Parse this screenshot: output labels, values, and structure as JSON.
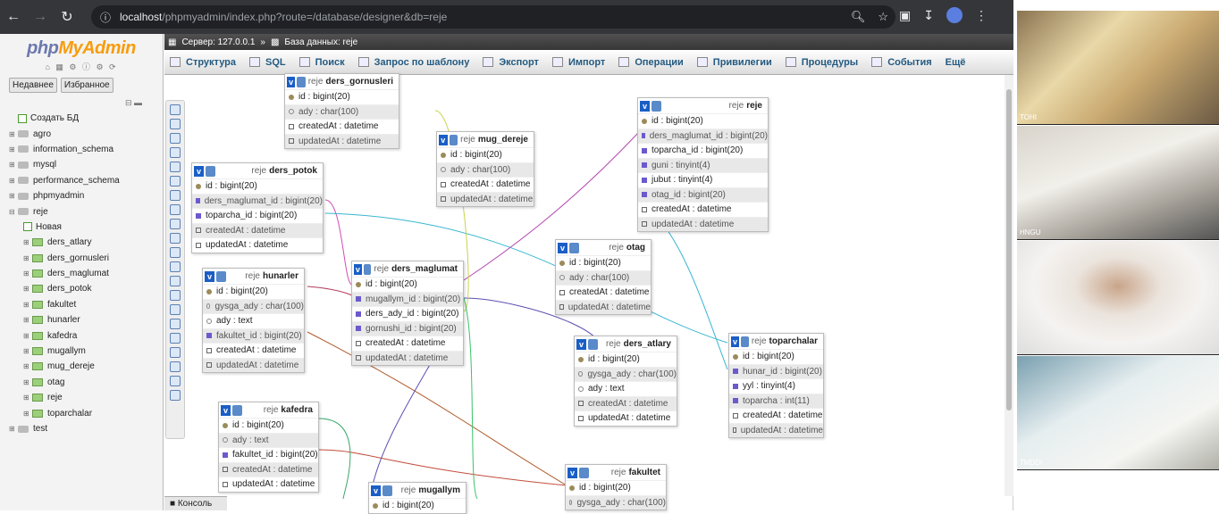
{
  "browser": {
    "url_prefix": "localhost",
    "url_path": "/phpmyadmin/index.php?route=/database/designer&db=reje"
  },
  "logo": {
    "php": "php",
    "myadmin": "MyAdmin"
  },
  "left": {
    "tab_recent": "Недавнее",
    "tab_favorites": "Избранное",
    "create_db": "Создать БД",
    "databases": [
      "agro",
      "information_schema",
      "mysql",
      "performance_schema",
      "phpmyadmin",
      "reje"
    ],
    "new_item": "Новая",
    "tables": [
      "ders_atlary",
      "ders_gornusleri",
      "ders_maglumat",
      "ders_potok",
      "fakultet",
      "hunarler",
      "kafedra",
      "mugallym",
      "mug_dereje",
      "otag",
      "reje",
      "toparchalar"
    ],
    "test_db": "test"
  },
  "pathbar": {
    "server": "Сервер: 127.0.0.1",
    "sep": "»",
    "db": "База данных: reje"
  },
  "tabs": [
    "Структура",
    "SQL",
    "Поиск",
    "Запрос по шаблону",
    "Экспорт",
    "Импорт",
    "Операции",
    "Привилегии",
    "Процедуры",
    "События",
    "Ещё"
  ],
  "console": "Консоль",
  "db_prefix": "reje",
  "designer_tables": {
    "ders_gornusleri": {
      "name": "ders_gornusleri",
      "rows": [
        "id : bigint(20)",
        "ady : char(100)",
        "createdAt : datetime",
        "updatedAt : datetime"
      ]
    },
    "ders_potok": {
      "name": "ders_potok",
      "rows": [
        "id : bigint(20)",
        "ders_maglumat_id : bigint(20)",
        "toparcha_id : bigint(20)",
        "createdAt : datetime",
        "updatedAt : datetime"
      ]
    },
    "mug_dereje": {
      "name": "mug_dereje",
      "rows": [
        "id : bigint(20)",
        "ady : char(100)",
        "createdAt : datetime",
        "updatedAt : datetime"
      ]
    },
    "reje": {
      "name": "reje",
      "rows": [
        "id : bigint(20)",
        "ders_maglumat_id : bigint(20)",
        "toparcha_id : bigint(20)",
        "guni : tinyint(4)",
        "jubut : tinyint(4)",
        "otag_id : bigint(20)",
        "createdAt : datetime",
        "updatedAt : datetime"
      ]
    },
    "otag": {
      "name": "otag",
      "rows": [
        "id : bigint(20)",
        "ady : char(100)",
        "createdAt : datetime",
        "updatedAt : datetime"
      ]
    },
    "hunarler": {
      "name": "hunarler",
      "rows": [
        "id : bigint(20)",
        "gysga_ady : char(100)",
        "ady : text",
        "fakultet_id : bigint(20)",
        "createdAt : datetime",
        "updatedAt : datetime"
      ]
    },
    "ders_maglumat": {
      "name": "ders_maglumat",
      "rows": [
        "id : bigint(20)",
        "mugallym_id : bigint(20)",
        "ders_ady_id : bigint(20)",
        "gornushi_id : bigint(20)",
        "createdAt : datetime",
        "updatedAt : datetime"
      ]
    },
    "ders_atlary": {
      "name": "ders_atlary",
      "rows": [
        "id : bigint(20)",
        "gysga_ady : char(100)",
        "ady : text",
        "createdAt : datetime",
        "updatedAt : datetime"
      ]
    },
    "toparchalar": {
      "name": "toparchalar",
      "rows": [
        "id : bigint(20)",
        "hunar_id : bigint(20)",
        "yyl : tinyint(4)",
        "toparcha : int(11)",
        "createdAt : datetime",
        "updatedAt : datetime"
      ]
    },
    "kafedra": {
      "name": "kafedra",
      "rows": [
        "id : bigint(20)",
        "ady : text",
        "fakultet_id : bigint(20)",
        "createdAt : datetime",
        "updatedAt : datetime"
      ]
    },
    "fakultet": {
      "name": "fakultet",
      "rows": [
        "id : bigint(20)",
        "gysga_ady : char(100)"
      ]
    },
    "mugallym": {
      "name": "mugallym",
      "rows": [
        "id : bigint(20)"
      ]
    }
  },
  "videos": [
    "TOHI",
    "HNGU",
    "",
    "TMDDI"
  ]
}
